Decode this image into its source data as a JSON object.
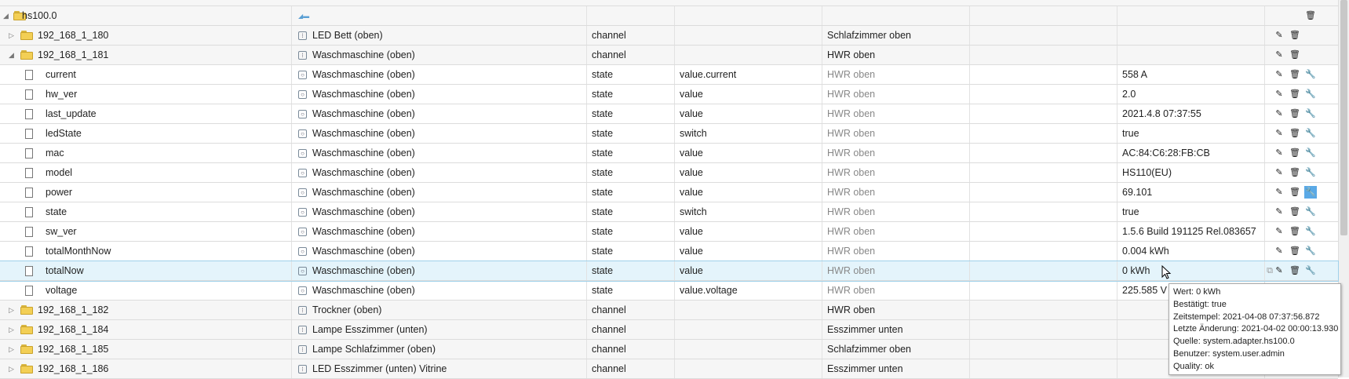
{
  "rows": [
    {
      "kind": "root",
      "id": "hs100.0",
      "name": "",
      "type": "",
      "role": "",
      "room": "",
      "func": "",
      "value": "",
      "level": 0,
      "expand": "open",
      "icon": "folder",
      "btns": [
        "delete"
      ]
    },
    {
      "kind": "channel",
      "id": "192_168_1_180",
      "name": "LED Bett (oben)",
      "type": "channel",
      "role": "",
      "room": "Schlafzimmer oben",
      "func": "",
      "value": "",
      "level": 1,
      "expand": "closed",
      "icon": "folder",
      "btns": [
        "edit",
        "delete"
      ]
    },
    {
      "kind": "channel",
      "id": "192_168_1_181",
      "name": "Waschmaschine (oben)",
      "type": "channel",
      "role": "",
      "room": "HWR oben",
      "func": "",
      "value": "",
      "level": 1,
      "expand": "open",
      "icon": "folder",
      "btns": [
        "edit",
        "delete"
      ]
    },
    {
      "kind": "state",
      "id": "current",
      "name": "Waschmaschine (oben)",
      "type": "state",
      "role": "value.current",
      "room": "HWR oben",
      "func": "",
      "value": "558 A",
      "level": 2,
      "btns": [
        "edit",
        "delete",
        "wrench"
      ]
    },
    {
      "kind": "state",
      "id": "hw_ver",
      "name": "Waschmaschine (oben)",
      "type": "state",
      "role": "value",
      "room": "HWR oben",
      "func": "",
      "value": "2.0",
      "level": 2,
      "btns": [
        "edit",
        "delete",
        "wrench"
      ]
    },
    {
      "kind": "state",
      "id": "last_update",
      "name": "Waschmaschine (oben)",
      "type": "state",
      "role": "value",
      "room": "HWR oben",
      "func": "",
      "value": "2021.4.8 07:37:55",
      "level": 2,
      "btns": [
        "edit",
        "delete",
        "wrench"
      ]
    },
    {
      "kind": "state",
      "id": "ledState",
      "name": "Waschmaschine (oben)",
      "type": "state",
      "role": "switch",
      "room": "HWR oben",
      "func": "",
      "value": "true",
      "level": 2,
      "btns": [
        "edit",
        "delete",
        "wrench"
      ]
    },
    {
      "kind": "state",
      "id": "mac",
      "name": "Waschmaschine (oben)",
      "type": "state",
      "role": "value",
      "room": "HWR oben",
      "func": "",
      "value": "AC:84:C6:28:FB:CB",
      "level": 2,
      "btns": [
        "edit",
        "delete",
        "wrench"
      ]
    },
    {
      "kind": "state",
      "id": "model",
      "name": "Waschmaschine (oben)",
      "type": "state",
      "role": "value",
      "room": "HWR oben",
      "func": "",
      "value": "HS110(EU)",
      "level": 2,
      "btns": [
        "edit",
        "delete",
        "wrench"
      ]
    },
    {
      "kind": "state",
      "id": "power",
      "name": "Waschmaschine (oben)",
      "type": "state",
      "role": "value",
      "room": "HWR oben",
      "func": "",
      "value": "69.101",
      "level": 2,
      "btns": [
        "edit",
        "delete",
        "wrench"
      ],
      "activeWrench": true
    },
    {
      "kind": "state",
      "id": "state",
      "name": "Waschmaschine (oben)",
      "type": "state",
      "role": "switch",
      "room": "HWR oben",
      "func": "",
      "value": "true",
      "level": 2,
      "btns": [
        "edit",
        "delete",
        "wrench"
      ]
    },
    {
      "kind": "state",
      "id": "sw_ver",
      "name": "Waschmaschine (oben)",
      "type": "state",
      "role": "value",
      "room": "HWR oben",
      "func": "",
      "value": "1.5.6 Build 191125 Rel.083657",
      "level": 2,
      "btns": [
        "edit",
        "delete",
        "wrench"
      ]
    },
    {
      "kind": "state",
      "id": "totalMonthNow",
      "name": "Waschmaschine (oben)",
      "type": "state",
      "role": "value",
      "room": "HWR oben",
      "func": "",
      "value": "0.004 kWh",
      "level": 2,
      "btns": [
        "edit",
        "delete",
        "wrench"
      ]
    },
    {
      "kind": "state",
      "id": "totalNow",
      "name": "Waschmaschine (oben)",
      "type": "state",
      "role": "value",
      "room": "HWR oben",
      "func": "",
      "value": "0 kWh",
      "level": 2,
      "btns": [
        "edit",
        "delete",
        "wrench"
      ],
      "selected": true
    },
    {
      "kind": "state",
      "id": "voltage",
      "name": "Waschmaschine (oben)",
      "type": "state",
      "role": "value.voltage",
      "room": "HWR oben",
      "func": "",
      "value": "225.585 V",
      "level": 2,
      "btns": [
        "edit",
        "delete",
        "wrench"
      ]
    },
    {
      "kind": "channel",
      "id": "192_168_1_182",
      "name": "Trockner (oben)",
      "type": "channel",
      "role": "",
      "room": "HWR oben",
      "func": "",
      "value": "",
      "level": 1,
      "expand": "closed",
      "icon": "folder",
      "btns": []
    },
    {
      "kind": "channel",
      "id": "192_168_1_184",
      "name": "Lampe Esszimmer (unten)",
      "type": "channel",
      "role": "",
      "room": "Esszimmer unten",
      "func": "",
      "value": "",
      "level": 1,
      "expand": "closed",
      "icon": "folder",
      "btns": []
    },
    {
      "kind": "channel",
      "id": "192_168_1_185",
      "name": "Lampe Schlafzimmer (oben)",
      "type": "channel",
      "role": "",
      "room": "Schlafzimmer oben",
      "func": "",
      "value": "",
      "level": 1,
      "expand": "closed",
      "icon": "folder",
      "btns": []
    },
    {
      "kind": "channel",
      "id": "192_168_1_186",
      "name": "LED Esszimmer (unten) Vitrine",
      "type": "channel",
      "role": "",
      "room": "Esszimmer unten",
      "func": "",
      "value": "",
      "level": 1,
      "expand": "closed",
      "icon": "folder",
      "btns": []
    }
  ],
  "tooltip": [
    "Wert: 0 kWh",
    "Bestätigt: true",
    "Zeitstempel: 2021-04-08 07:37:56.872",
    "Letzte Änderung: 2021-04-02 00:00:13.930",
    "Quelle: system.adapter.hs100.0",
    "Benutzer: system.user.admin",
    "Quality: ok"
  ],
  "icons": {
    "edit": "✎",
    "delete": "🗑",
    "wrench": "🔧",
    "copy": "⧉",
    "open": "◢",
    "closed": "▷"
  },
  "colors": {
    "selectedRow": "#e4f4fb",
    "activeButton": "#5aa9e6",
    "folder": "#f3cf55",
    "mutedText": "#888888"
  }
}
